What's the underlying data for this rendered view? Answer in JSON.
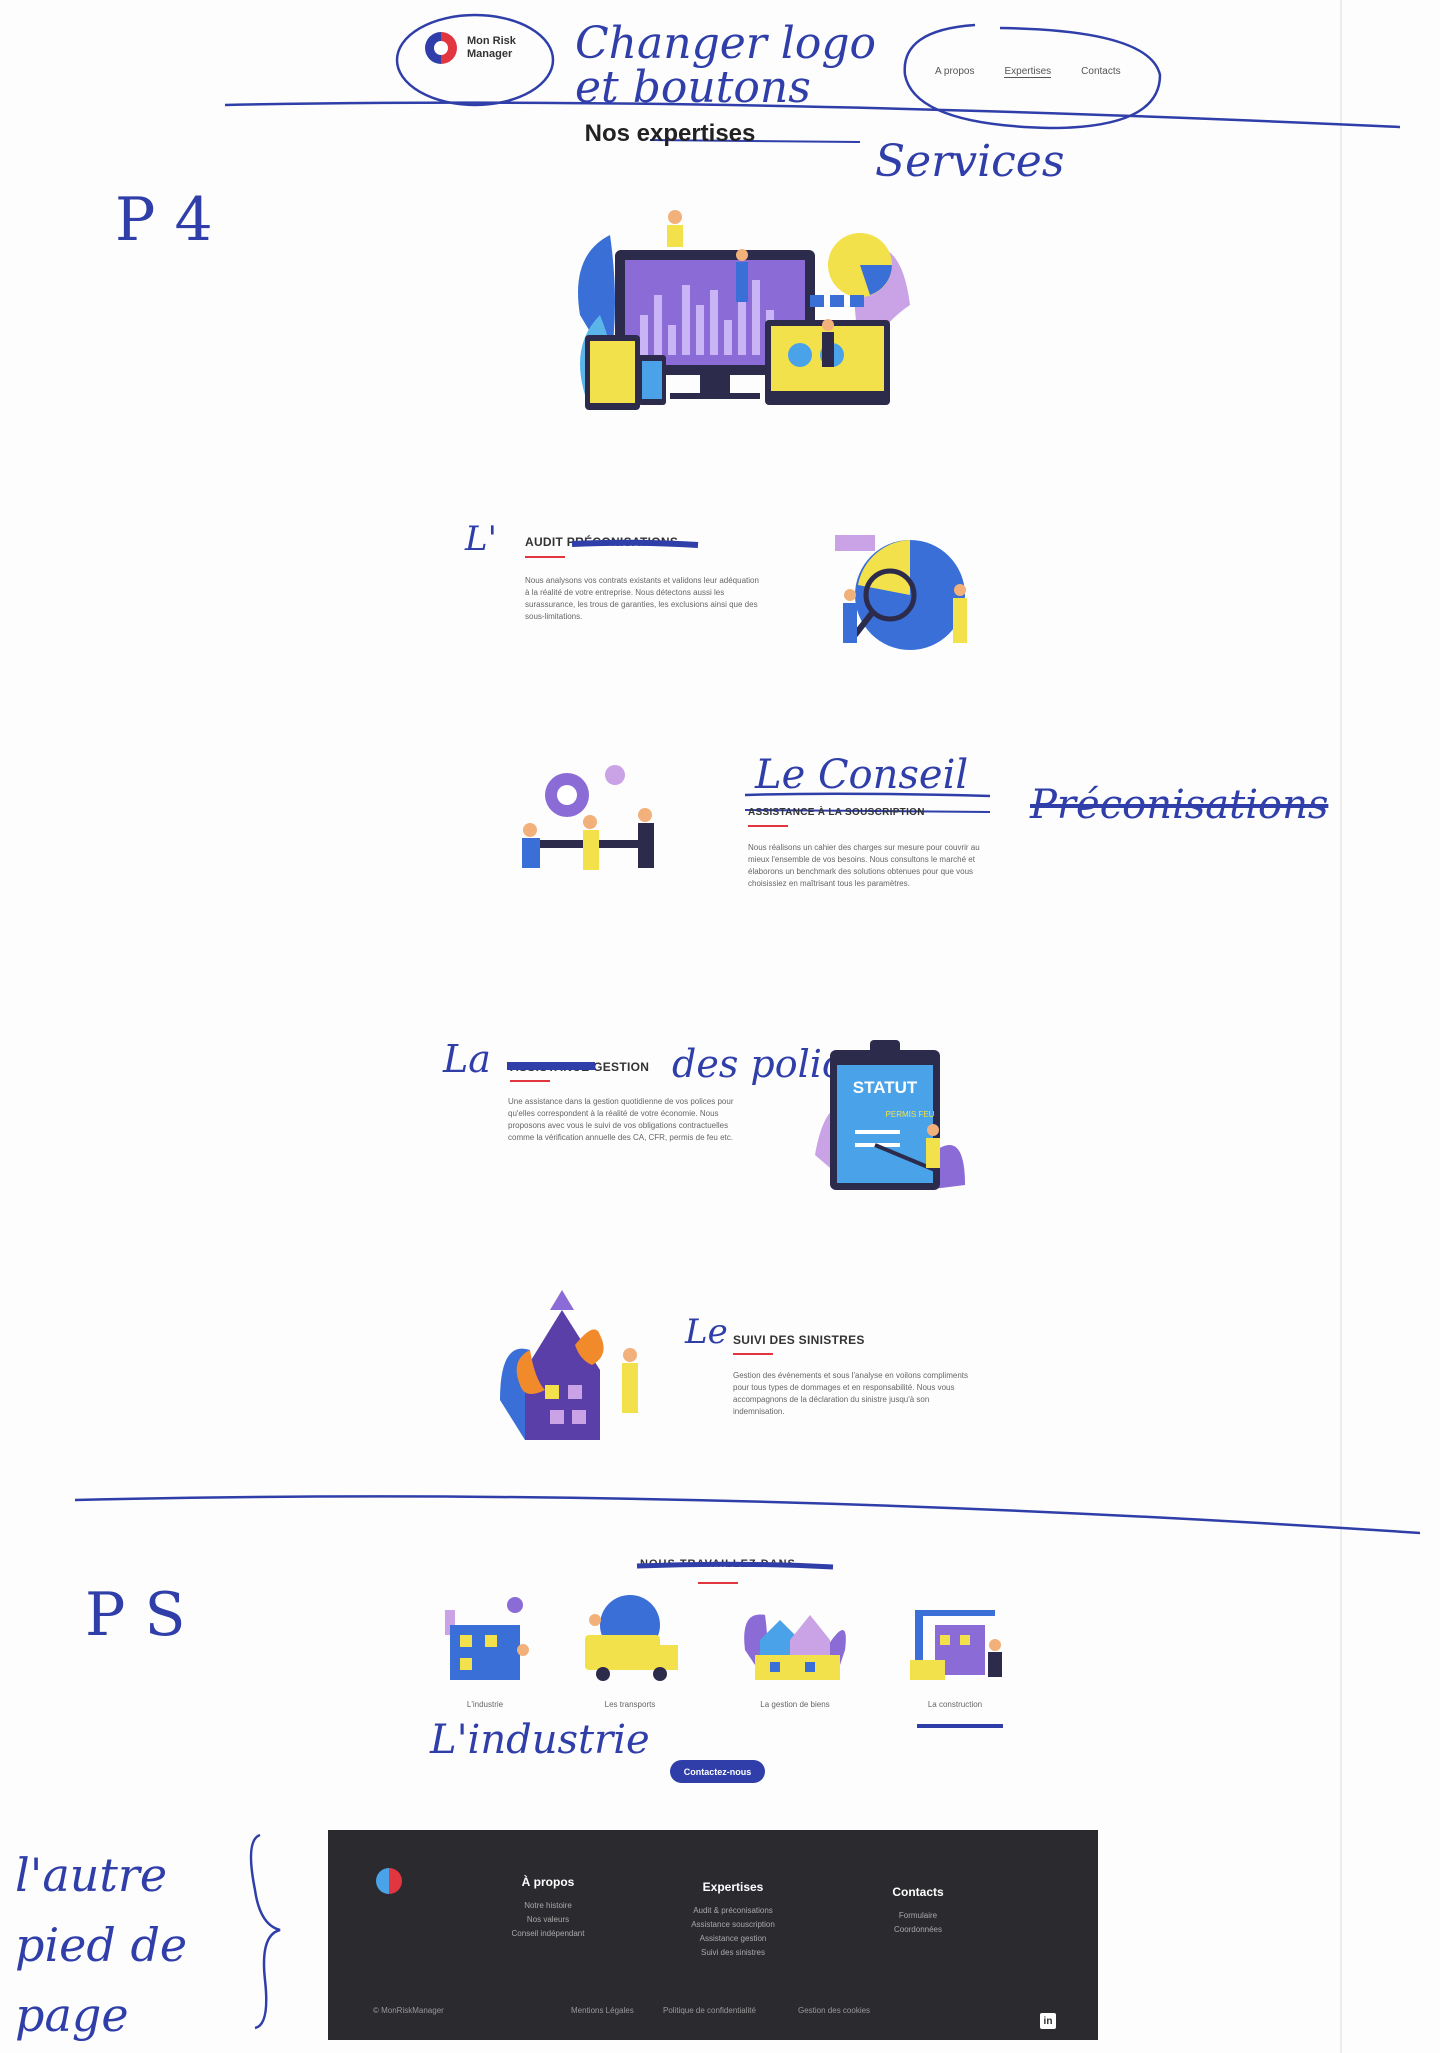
{
  "header": {
    "logo_text": "Mon Risk Manager",
    "nav": [
      "A propos",
      "Expertises",
      "Contacts"
    ]
  },
  "page_title": "Nos expertises",
  "annotations": {
    "p4": "P 4",
    "p5": "P S",
    "change_logo": "Changer logo et boutons",
    "services": "Services",
    "le": "L'",
    "le_conseil": "Le Conseil",
    "preconisations": "Préconisations",
    "la": "La",
    "des_polices": "des polices",
    "le2": "Le",
    "industrie": "L'industrie",
    "autre_pied": "l'autre pied de page"
  },
  "sections": {
    "audit": {
      "title": "AUDIT PRÉCONISATIONS",
      "text": "Nous analysons vos contrats existants et validons leur adéquation à la réalité de votre entreprise. Nous détectons aussi les surassurance, les trous de garanties, les exclusions ainsi que des sous-limitations."
    },
    "souscription": {
      "title": "ASSISTANCE À LA SOUSCRIPTION",
      "text": "Nous réalisons un cahier des charges sur mesure pour couvrir au mieux l'ensemble de vos besoins. Nous consultons le marché et élaborons un benchmark des solutions obtenues pour que vous choisissiez en maîtrisant tous les paramètres."
    },
    "gestion": {
      "title": "ASSISTANCE GESTION",
      "text": "Une assistance dans la gestion quotidienne de vos polices pour qu'elles correspondent à la réalité de votre économie. Nous proposons avec vous le suivi de vos obligations contractuelles comme la vérification annuelle des CA, CFR, permis de feu etc."
    },
    "sinistres": {
      "title": "SUIVI DES SINISTRES",
      "text": "Gestion des évènements et sous l'analyse en voilons compliments pour tous types de dommages et en responsabilité. Nous vous accompagnons de la déclaration du sinistre jusqu'à son indemnisation."
    }
  },
  "illustration_text": {
    "statut": "STATUT",
    "permis_feu": "PERMIS FEU"
  },
  "industries": {
    "title": "NOUS TRAVAILLEZ DANS...",
    "items": [
      "L'industrie",
      "Les transports",
      "La gestion de biens",
      "La construction"
    ],
    "button": "Contactez-nous"
  },
  "footer": {
    "cols": [
      {
        "title": "À propos",
        "items": [
          "Notre histoire",
          "Nos valeurs",
          "Conseil indépendant"
        ]
      },
      {
        "title": "Expertises",
        "items": [
          "Audit & préconisations",
          "Assistance souscription",
          "Assistance gestion",
          "Suivi des sinistres"
        ]
      },
      {
        "title": "Contacts",
        "items": [
          "Formulaire",
          "Coordonnées"
        ]
      }
    ],
    "copyright": "© MonRiskManager",
    "bottom_links": [
      "Mentions Légales",
      "Politique de confidentialité",
      "Gestion des cookies"
    ],
    "linkedin": "in"
  },
  "colors": {
    "brand_blue": "#2f3ea8",
    "brand_red": "#e1363f",
    "footer_bg": "#2b2a2f",
    "ink": "#2f3ea8"
  }
}
